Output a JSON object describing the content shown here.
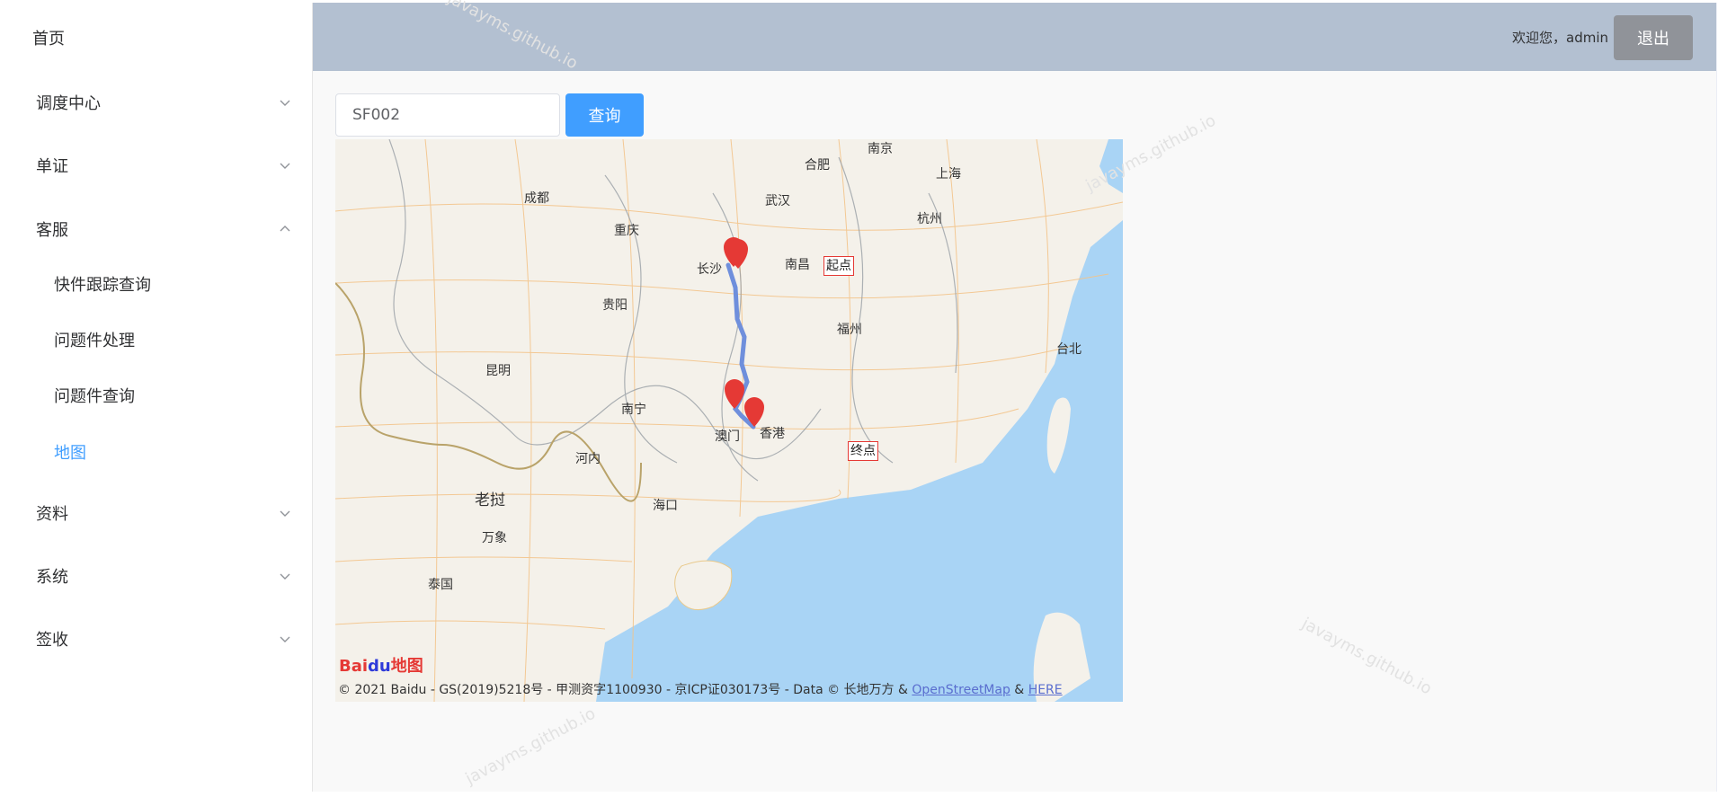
{
  "sidebar": {
    "items": [
      {
        "label": "首页"
      },
      {
        "label": "调度中心"
      },
      {
        "label": "单证"
      },
      {
        "label": "客服"
      },
      {
        "label": "资料"
      },
      {
        "label": "系统"
      },
      {
        "label": "签收"
      }
    ],
    "sub_items": [
      {
        "label": "快件跟踪查询"
      },
      {
        "label": "问题件处理"
      },
      {
        "label": "问题件查询"
      },
      {
        "label": "地图"
      }
    ]
  },
  "header": {
    "welcome": "欢迎您，admin",
    "logout_label": "退出"
  },
  "query": {
    "value": "SF002",
    "button_label": "查询"
  },
  "map": {
    "cities": [
      "南京",
      "合肥",
      "上海",
      "成都",
      "武汉",
      "杭州",
      "重庆",
      "长沙",
      "南昌",
      "贵阳",
      "福州",
      "台北",
      "昆明",
      "南宁",
      "澳门",
      "香港",
      "河内",
      "老挝",
      "海口",
      "万象",
      "泰国"
    ],
    "start_label": "起点",
    "end_label": "终点",
    "logo_bai": "Bai",
    "logo_du": "du",
    "logo_map": "地图",
    "copyright_text": "© 2021 Baidu - GS(2019)5218号 - 甲测资字1100930 - 京ICP证030173号 - Data © 长地万方 & ",
    "link_osm": "OpenStreetMap",
    "amp": " & ",
    "link_here": "HERE",
    "route_color": "#6f8fdc",
    "pin_color": "#e53935",
    "sea_color": "#a9d4f5"
  },
  "watermark": "javayms.github.io"
}
